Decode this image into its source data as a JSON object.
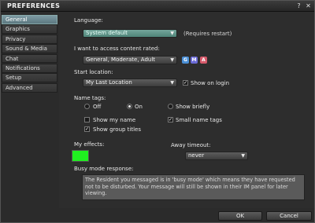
{
  "window": {
    "title": "PREFERENCES",
    "help_label": "?",
    "close_label": "✕"
  },
  "sidebar": {
    "items": [
      {
        "label": "General"
      },
      {
        "label": "Graphics"
      },
      {
        "label": "Privacy"
      },
      {
        "label": "Sound & Media"
      },
      {
        "label": "Chat"
      },
      {
        "label": "Notifications"
      },
      {
        "label": "Setup"
      },
      {
        "label": "Advanced"
      }
    ]
  },
  "general": {
    "language": {
      "label": "Language:",
      "value": "System default",
      "note": "(Requires restart)"
    },
    "content_rating": {
      "label": "I want to access content rated:",
      "value": "General, Moderate, Adult",
      "badges": [
        {
          "text": "G",
          "color": "#4a8fd6"
        },
        {
          "text": "M",
          "color": "#6b6bd6"
        },
        {
          "text": "A",
          "color": "#d65a6b"
        }
      ]
    },
    "start_location": {
      "label": "Start location:",
      "value": "My Last Location",
      "show_on_login": {
        "label": "Show on login",
        "checked": true
      }
    },
    "name_tags": {
      "label": "Name tags:",
      "options": [
        {
          "label": "Off",
          "selected": false
        },
        {
          "label": "On",
          "selected": true
        },
        {
          "label": "Show briefly",
          "selected": false
        }
      ],
      "show_my_name": {
        "label": "Show my name",
        "checked": false
      },
      "small_name_tags": {
        "label": "Small name tags",
        "checked": true
      },
      "show_group_titles": {
        "label": "Show group titles",
        "checked": true
      }
    },
    "effects": {
      "label": "My effects:",
      "color": "#20f020"
    },
    "away_timeout": {
      "label": "Away timeout:",
      "value": "never"
    },
    "busy_mode": {
      "label": "Busy mode response:",
      "text": "The Resident you messaged is in 'busy mode' which means they have requested not to be disturbed.  Your message will still be shown in their IM panel for later viewing."
    }
  },
  "footer": {
    "ok_label": "OK",
    "cancel_label": "Cancel"
  }
}
